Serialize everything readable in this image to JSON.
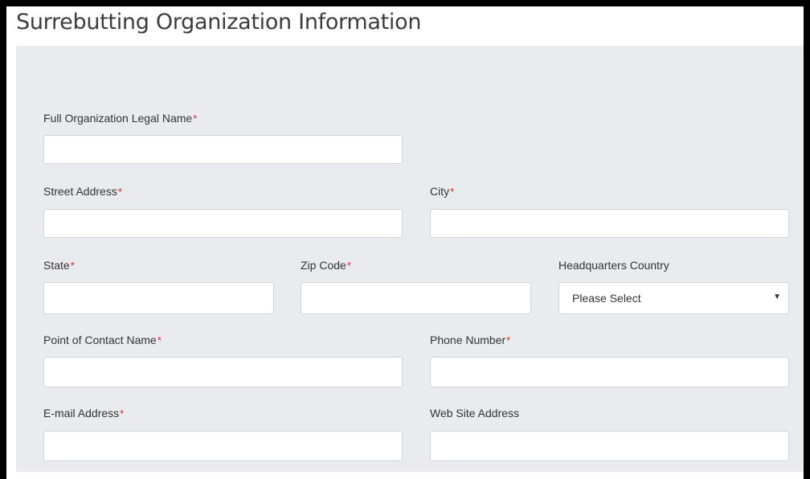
{
  "page": {
    "title": "Surrebutting Organization Information"
  },
  "form": {
    "required_marker": "*",
    "full_org_name": {
      "label": "Full Organization Legal Name",
      "value": "",
      "required": true
    },
    "street_address": {
      "label": "Street Address",
      "value": "",
      "required": true
    },
    "city": {
      "label": "City",
      "value": "",
      "required": true
    },
    "state": {
      "label": "State",
      "value": "",
      "required": true
    },
    "zip_code": {
      "label": "Zip Code",
      "value": "",
      "required": true
    },
    "hq_country": {
      "label": "Headquarters Country",
      "selected": "Please Select",
      "required": false
    },
    "poc_name": {
      "label": "Point of Contact Name",
      "value": "",
      "required": true
    },
    "phone_number": {
      "label": "Phone Number",
      "value": "",
      "required": true
    },
    "email_address": {
      "label": "E-mail Address",
      "value": "",
      "required": true
    },
    "website_address": {
      "label": "Web Site Address",
      "value": "",
      "required": false
    }
  },
  "icons": {
    "dropdown_arrow": "▼"
  },
  "colors": {
    "panel_background": "#e9ebee",
    "required_asterisk": "#e0262b",
    "frame_border": "#000000"
  }
}
